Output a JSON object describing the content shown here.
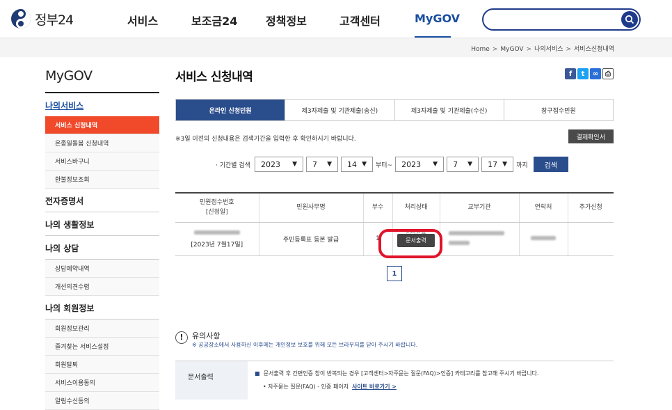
{
  "header": {
    "logo_text": "정부24",
    "nav": [
      "서비스",
      "보조금24",
      "정책정보",
      "고객센터",
      "MyGOV"
    ],
    "search_placeholder": ""
  },
  "breadcrumb": [
    "Home",
    "MyGOV",
    "나의서비스",
    "서비스신청내역"
  ],
  "sidebar": {
    "title": "MyGOV",
    "sections": [
      {
        "label": "나의서비스",
        "items": [
          "서비스 신청내역",
          "온종일돌봄 신청내역",
          "서비스바구니",
          "환불정보조회"
        ]
      },
      {
        "label": "전자증명서",
        "items": []
      },
      {
        "label": "나의 생활정보",
        "items": []
      },
      {
        "label": "나의 상담",
        "items": [
          "상담예약내역",
          "개선의견수렴"
        ]
      },
      {
        "label": "나의 회원정보",
        "items": [
          "회원정보관리",
          "즐겨찾는 서비스설정",
          "회원탈퇴",
          "서비스이용동의",
          "알림수신동의"
        ]
      }
    ]
  },
  "main": {
    "title": "서비스 신청내역",
    "tabs": [
      "온라인 신청민원",
      "제3자제출 및 기관제출(송신)",
      "제3자제출 및 기관제출(수신)",
      "창구접수민원"
    ],
    "note": "※3일 이전의 신청내용은 검색기간을 입력한 후 확인하시기 바랍니다.",
    "cert_button": "결제확인서",
    "period": {
      "label": "· 기간별 검색",
      "from": {
        "year": "2023",
        "month": "7",
        "day": "14"
      },
      "from_suffix": "부터~",
      "to": {
        "year": "2023",
        "month": "7",
        "day": "17"
      },
      "to_suffix": "까지",
      "search_button": "검색"
    },
    "table": {
      "headers": [
        "민원접수번호\n[신청일]",
        "민원사무명",
        "부수",
        "처리상태",
        "교부기관",
        "연락처",
        "추가신청"
      ],
      "row": {
        "date": "[2023년 7월17일]",
        "name": "주민등록표 등본 발급",
        "count": "1",
        "status_partial": "처리완료",
        "print_button": "문서출력"
      }
    },
    "pagination": [
      "1"
    ],
    "notice": {
      "heading": "유의사항",
      "text": "※ 공공장소에서 사용하신 이후에는 개인정보 보호를 위해 모든 브라우저를 닫아 주시기 바랍니다."
    },
    "info": {
      "key": "문서출력",
      "line1": "문서출력 후 간편인증 창이 반복되는 경우 [고객센터>자주묻는 질문(FAQ)>인증] 카테고리를 참고해 주시기 바랍니다.",
      "line2_prefix": "• 자주묻는 질문(FAQ) - 인증 페이지",
      "line2_link": "사이트 바로가기 >"
    }
  }
}
